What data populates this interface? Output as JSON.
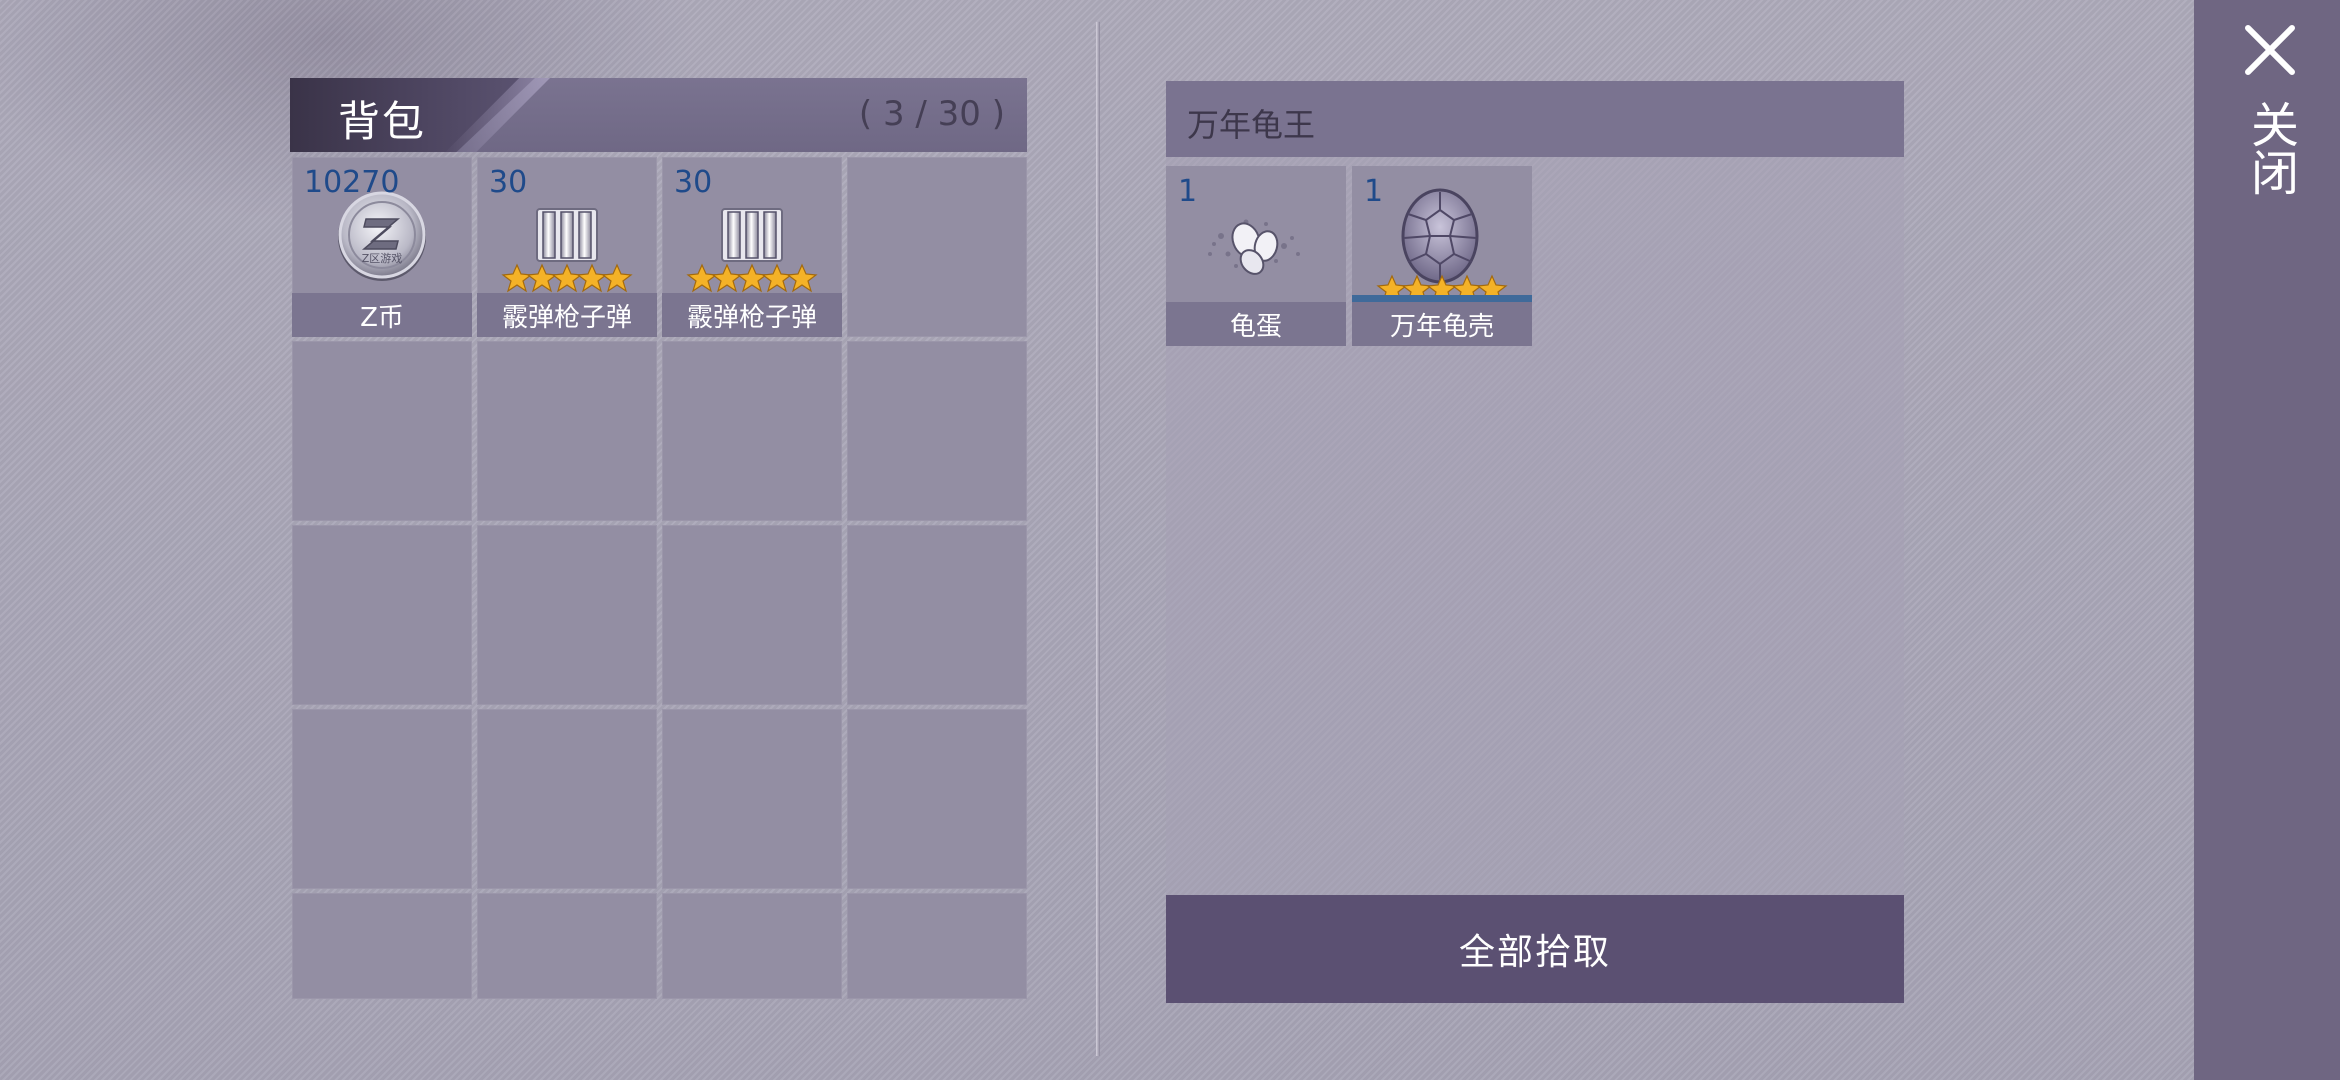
{
  "backpack": {
    "title": "背包",
    "count": "( 3 / 30 )",
    "items": [
      {
        "name": "Z币",
        "qty": "10270",
        "icon": "z-coin-icon",
        "stars": 0
      },
      {
        "name": "霰弹枪子弹",
        "qty": "30",
        "icon": "shotgun-ammo-icon",
        "stars": 5
      },
      {
        "name": "霰弹枪子弹",
        "qty": "30",
        "icon": "shotgun-ammo-icon",
        "stars": 5
      }
    ],
    "coin_text": "Z区游戏"
  },
  "loot": {
    "title": "万年龟王",
    "items": [
      {
        "name": "龟蛋",
        "qty": "1",
        "icon": "turtle-egg-icon",
        "stars": 0
      },
      {
        "name": "万年龟壳",
        "qty": "1",
        "icon": "turtle-shell-icon",
        "stars": 5
      }
    ],
    "pickup_all_label": "全部拾取"
  },
  "close": {
    "label": "关闭",
    "icon": "close-icon"
  },
  "colors": {
    "qty_text": "#1f4a8a",
    "slot_bg": "#938ea3",
    "name_bar": "#7b7590",
    "button_bg": "#5b5072",
    "close_panel": "#6f6682"
  }
}
